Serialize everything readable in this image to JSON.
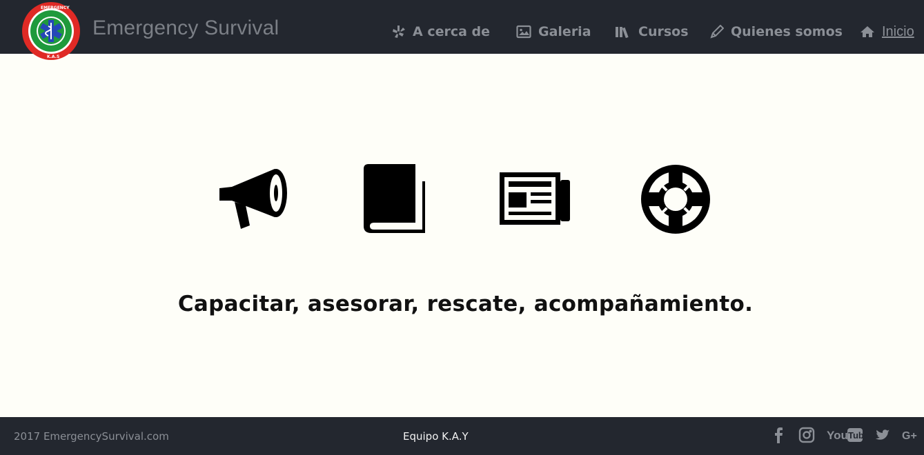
{
  "header": {
    "brand": "Emergency Survival",
    "nav": [
      {
        "label": "A cerca de",
        "icon": "yelp-icon"
      },
      {
        "label": "Galeria",
        "icon": "image-icon"
      },
      {
        "label": "Cursos",
        "icon": "books-icon"
      },
      {
        "label": "Quienes somos",
        "icon": "pencil-icon"
      },
      {
        "label": "Inicio",
        "icon": "home-icon"
      }
    ]
  },
  "main": {
    "features": [
      {
        "icon": "megaphone-icon"
      },
      {
        "icon": "book-icon"
      },
      {
        "icon": "newspaper-icon"
      },
      {
        "icon": "life-ring-icon"
      }
    ],
    "headline": "Capacitar, asesorar, rescate, acompañamiento."
  },
  "footer": {
    "copyright": "2017 EmergencySurvival.com",
    "team": "Equipo K.A.Y",
    "social": [
      "facebook-icon",
      "instagram-icon",
      "youtube-icon",
      "twitter-icon",
      "google-plus-icon"
    ]
  },
  "colors": {
    "navbar_bg": "#23272f",
    "page_bg": "#fefef8",
    "nav_text": "#8b8f96",
    "logo_red": "#e02a25",
    "logo_green": "#1f9a3c",
    "logo_blue": "#2547b8"
  }
}
